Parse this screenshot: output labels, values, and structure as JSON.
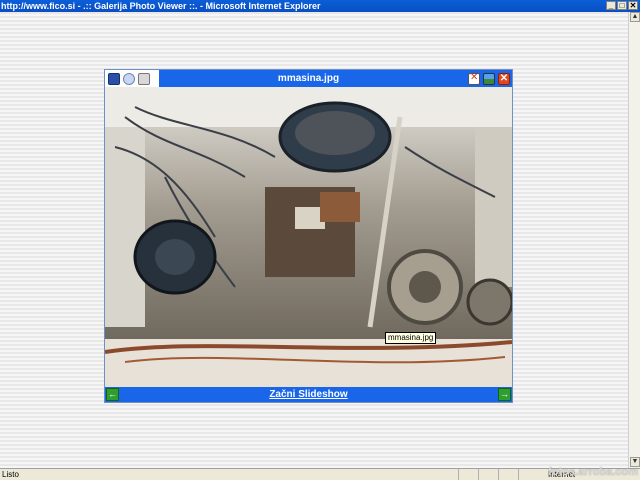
{
  "window": {
    "title": "http://www.fico.si - .:: Galerija Photo Viewer ::. - Microsoft Internet Explorer",
    "minimize_glyph": "_",
    "maximize_glyph": "□",
    "close_glyph": "✕"
  },
  "viewer": {
    "title": "mmasina.jpg",
    "close_glyph": "✕",
    "tooltip": "mmasina.jpg",
    "slideshow_label": "Začni Slideshow",
    "prev_glyph": "←",
    "next_glyph": "→",
    "icons": {
      "left": [
        "save-icon",
        "email-icon",
        "print-icon"
      ],
      "right": [
        "fullscreen-icon",
        "picture-icon",
        "close-icon"
      ]
    }
  },
  "scrollbar": {
    "up_glyph": "▲",
    "down_glyph": "▼"
  },
  "statusbar": {
    "status": "Listo",
    "zone": "Internet"
  },
  "watermark": "fotos.arroba.com",
  "colors": {
    "titlebar": "#0a4ec3",
    "viewer_bar": "#1a66e8",
    "nav_button": "#2e9e2e",
    "close_button": "#e0471f"
  }
}
